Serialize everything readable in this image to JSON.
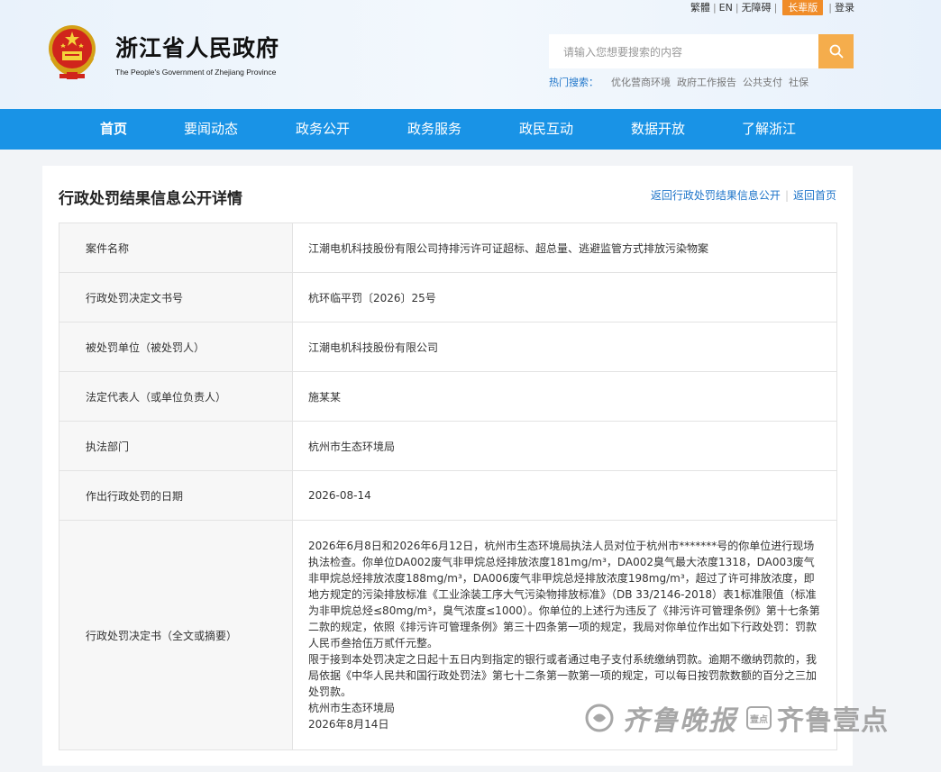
{
  "toplinks": {
    "traditional": "繁體",
    "english": "EN",
    "accessibility": "无障碍",
    "elder": "长辈版",
    "login": "登录"
  },
  "site": {
    "title": "浙江省人民政府",
    "subtitle": "The People's Government of Zhejiang Province"
  },
  "search": {
    "placeholder": "请输入您想要搜索的内容",
    "hot_label": "热门搜索：",
    "hot_items": [
      "优化营商环境",
      "政府工作报告",
      "公共支付",
      "社保"
    ]
  },
  "nav": [
    "首页",
    "要闻动态",
    "政务公开",
    "政务服务",
    "政民互动",
    "数据开放",
    "了解浙江"
  ],
  "page": {
    "title": "行政处罚结果信息公开详情",
    "back_list": "返回行政处罚结果信息公开",
    "back_home": "返回首页"
  },
  "rows": [
    {
      "key": "案件名称",
      "value": "江潮电机科技股份有限公司持排污许可证超标、超总量、逃避监管方式排放污染物案"
    },
    {
      "key": "行政处罚决定文书号",
      "value": "杭环临平罚〔2026〕25号"
    },
    {
      "key": "被处罚单位（被处罚人）",
      "value": "江潮电机科技股份有限公司"
    },
    {
      "key": "法定代表人（或单位负责人）",
      "value": "施某某"
    },
    {
      "key": "执法部门",
      "value": "杭州市生态环境局"
    },
    {
      "key": "作出行政处罚的日期",
      "value": "2026-08-14"
    }
  ],
  "decision": {
    "key": "行政处罚决定书（全文或摘要）",
    "paragraphs": [
      "2026年6月8日和2026年6月12日，杭州市生态环境局执法人员对位于杭州市*******号的你单位进行现场执法检查。你单位DA002废气非甲烷总烃排放浓度181mg/m³，DA002臭气最大浓度1318，DA003废气非甲烷总烃排放浓度188mg/m³，DA006废气非甲烷总烃排放浓度198mg/m³，超过了许可排放浓度，即地方规定的污染排放标准《工业涂装工序大气污染物排放标准》（DB 33/2146-2018）表1标准限值（标准为非甲烷总烃≤80mg/m³，臭气浓度≤1000）。你单位的上述行为违反了《排污许可管理条例》第十七条第二款的规定，依照《排污许可管理条例》第三十四条第一项的规定，我局对你单位作出如下行政处罚：罚款人民币叁拾伍万贰仟元整。",
      "限于接到本处罚决定之日起十五日内到指定的银行或者通过电子支付系统缴纳罚款。逾期不缴纳罚款的，我局依据《中华人民共和国行政处罚法》第七十二条第一款第一项的规定，可以每日按罚款数额的百分之三加处罚款。",
      "杭州市生态环境局",
      "2026年8月14日"
    ]
  },
  "watermark": {
    "brand1": "齐鲁晚报",
    "badge": "壹点",
    "brand2": "齐鲁壹点"
  },
  "colors": {
    "nav_bg": "#1993e6",
    "search_btn": "#f5ad4c",
    "elder_badge": "#f08c28",
    "link": "#1d74c9"
  }
}
